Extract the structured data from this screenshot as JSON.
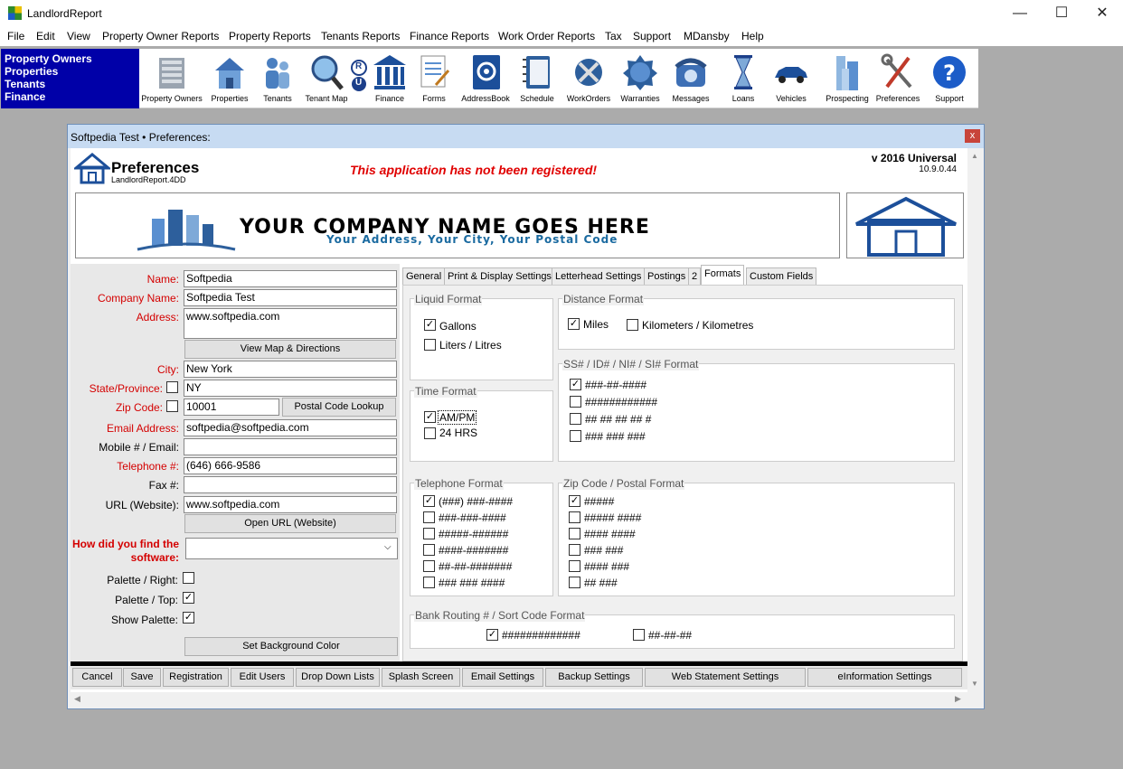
{
  "app": {
    "title": "LandlordReport"
  },
  "menu": [
    "File",
    "Edit",
    "View",
    "Property Owner Reports",
    "Property Reports",
    "Tenants Reports",
    "Finance Reports",
    "Work Order Reports",
    "Tax",
    "Support",
    "MDansby",
    "Help"
  ],
  "nav": [
    "Property Owners",
    "Properties",
    "Tenants",
    "Finance"
  ],
  "toolbar": {
    "property_owners": "Property Owners",
    "properties": "Properties",
    "tenants": "Tenants",
    "tenant_map": "Tenant Map",
    "ru_r": "R",
    "ru_u": "U",
    "finance": "Finance",
    "forms": "Forms",
    "addressbook": "AddressBook",
    "schedule": "Schedule",
    "workorders": "WorkOrders",
    "warranties": "Warranties",
    "messages": "Messages",
    "loans": "Loans",
    "vehicles": "Vehicles",
    "prospecting": "Prospecting",
    "preferences": "Preferences",
    "support": "Support"
  },
  "window": {
    "title": "Softpedia Test  •  Preferences:",
    "close": "x"
  },
  "header": {
    "title": "Preferences",
    "subtitle": "LandlordReport.4DD",
    "unregistered": "This application has not been registered!",
    "version": "v 2016 Universal",
    "build": "10.9.0.44"
  },
  "banner": {
    "company": "YOUR COMPANY NAME GOES HERE",
    "address": "Your Address, Your City, Your Postal Code"
  },
  "form": {
    "name_label": "Name:",
    "name_value": "Softpedia",
    "company_label": "Company Name:",
    "company_value": "Softpedia Test",
    "address_label": "Address:",
    "address_value": "www.softpedia.com",
    "view_map_button": "View Map & Directions",
    "city_label": "City:",
    "city_value": "New York",
    "state_label": "State/Province:",
    "state_value": "NY",
    "zip_label": "Zip Code:",
    "zip_value": "10001",
    "postal_lookup_button": "Postal Code Lookup",
    "email_label": "Email Address:",
    "email_value": "softpedia@softpedia.com",
    "mobile_label": "Mobile # / Email:",
    "mobile_value": "",
    "telephone_label": "Telephone #:",
    "telephone_value": "(646) 666-9586",
    "fax_label": "Fax #:",
    "fax_value": "",
    "url_label": "URL (Website):",
    "url_value": "www.softpedia.com",
    "open_url_button": "Open URL (Website)",
    "how_found_label_1": "How did you find the",
    "how_found_label_2": "software:",
    "how_found_value": "",
    "palette_right_label": "Palette / Right:",
    "palette_top_label": "Palette / Top:",
    "show_palette_label": "Show Palette:",
    "palette_right_check": "",
    "palette_top_check": "✓",
    "show_palette_check": "✓",
    "set_bg_button": "Set Background Color"
  },
  "tabs": [
    "General",
    "Print & Display Settings",
    "Letterhead Settings",
    "Postings",
    "2",
    "Formats",
    "Custom Fields"
  ],
  "formats": {
    "liquid_title": "Liquid Format",
    "gallons": "Gallons",
    "liters": "Liters / Litres",
    "distance_title": "Distance Format",
    "miles": "Miles",
    "km": "Kilometers / Kilometres",
    "time_title": "Time Format",
    "ampm": "AM/PM",
    "hrs24": "24 HRS",
    "ssn_title": "SS# / ID# / NI# / SI# Format",
    "ssn1": "###-##-####",
    "ssn2": "############",
    "ssn3": "## ## ## ## #",
    "ssn4": "### ### ###",
    "tel_title": "Telephone Format",
    "tel1": "(###)  ###-####",
    "tel2": "###-###-####",
    "tel3": "#####-######",
    "tel4": "####-#######",
    "tel5": "##-##-#######",
    "tel6": "### ### ####",
    "zip_title": "Zip Code / Postal Format",
    "zip1": "#####",
    "zip2": "##### ####",
    "zip3": "#### ####",
    "zip4": "### ###",
    "zip5": "#### ###",
    "zip6": "## ###",
    "bank_title": "Bank Routing # / Sort Code Format",
    "bank1": "#############",
    "bank2": "##-##-##",
    "check": "✓"
  },
  "bottom_buttons": [
    "Cancel",
    "Save",
    "Registration",
    "Edit Users",
    "Drop Down Lists",
    "Splash Screen",
    "Email Settings",
    "Backup Settings",
    "Web Statement Settings",
    "eInformation Settings"
  ],
  "colors": {
    "nav_bg": "#0000a8",
    "required_label": "#d40000",
    "unregistered": "#e00000",
    "titlebar": "#c7dbf2"
  }
}
